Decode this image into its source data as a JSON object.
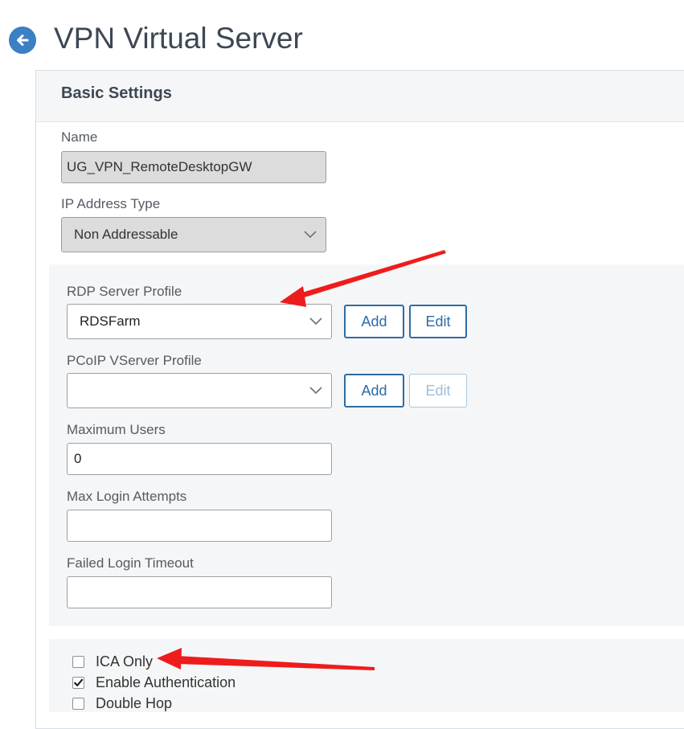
{
  "header": {
    "title": "VPN Virtual Server",
    "back_icon": "arrow-left-circle-icon"
  },
  "section": {
    "title": "Basic Settings",
    "name_label": "Name",
    "name_value": "UG_VPN_RemoteDesktopGW",
    "ip_type_label": "IP Address Type",
    "ip_type_value": "Non Addressable",
    "rdp_label": "RDP Server Profile",
    "rdp_value": "RDSFarm",
    "pcoip_label": "PCoIP VServer Profile",
    "pcoip_value": "",
    "max_users_label": "Maximum Users",
    "max_users_value": "0",
    "max_login_label": "Max Login Attempts",
    "max_login_value": "",
    "failed_timeout_label": "Failed Login Timeout",
    "failed_timeout_value": ""
  },
  "buttons": {
    "add": "Add",
    "edit": "Edit"
  },
  "checkboxes": [
    {
      "label": "ICA Only",
      "checked": false
    },
    {
      "label": "Enable Authentication",
      "checked": true
    },
    {
      "label": "Double Hop",
      "checked": false
    }
  ],
  "colors": {
    "accent": "#2d6ca5",
    "annotation_arrow": "#ee1c1c"
  }
}
